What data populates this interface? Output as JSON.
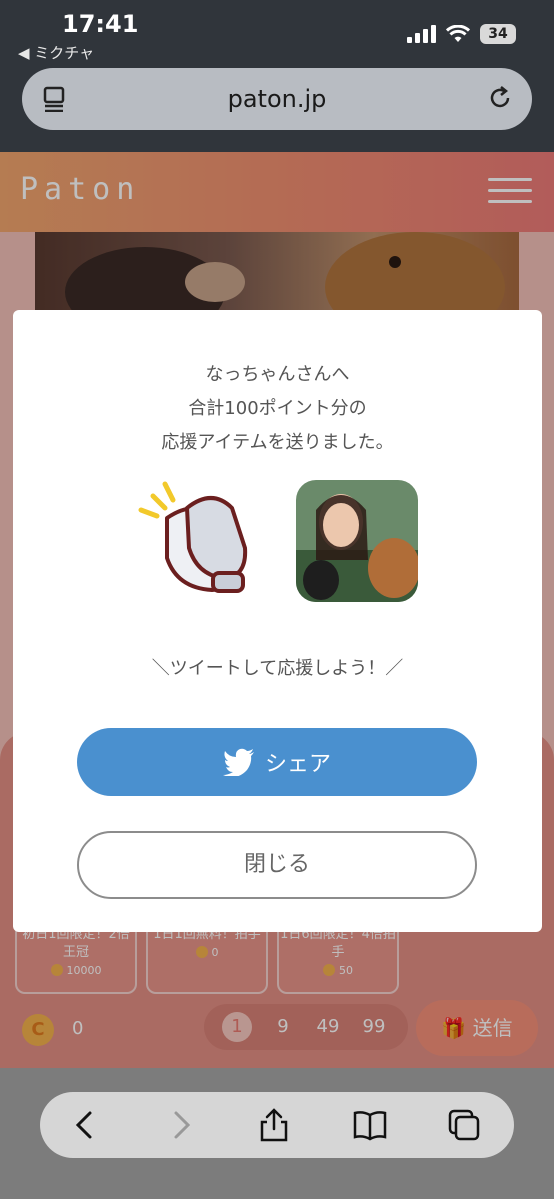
{
  "status_bar": {
    "time": "17:41",
    "back_app": "◀ ミクチャ",
    "battery": "34",
    "url": "paton.jp"
  },
  "header": {
    "logo": "Paton"
  },
  "items": [
    {
      "name": "初日1回限定！2倍王冠",
      "price": "10000"
    },
    {
      "name": "1日1回無料！拍手",
      "price": "0"
    },
    {
      "name": "1日6回限定！4倍拍手",
      "price": "50"
    }
  ],
  "footer_bar": {
    "coin_symbol": "C",
    "coin_balance": "0",
    "quantities": [
      "1",
      "9",
      "49",
      "99"
    ],
    "selected_quantity": "1",
    "send_label": "送信"
  },
  "modal": {
    "line1": "なっちゃんさんへ",
    "line2": "合計100ポイント分の",
    "line3": "応援アイテムを送りました。",
    "prompt": "＼ツイートして応援しよう！／",
    "share_label": "シェア",
    "close_label": "閉じる"
  },
  "colors": {
    "share_blue": "#4a90cf",
    "header_gradient_start": "#f2a66e",
    "header_gradient_end": "#ee7b78",
    "send_button": "#f6917a"
  },
  "icons": {
    "reader": "reader-mode-icon",
    "reload": "reload-icon",
    "menu": "hamburger-menu-icon",
    "clap": "clapping-hands-icon",
    "twitter": "twitter-bird-icon",
    "gift": "gift-icon",
    "back": "chevron-left-icon",
    "forward": "chevron-right-icon",
    "share": "share-icon",
    "bookmarks": "book-icon",
    "tabs": "tabs-icon"
  }
}
